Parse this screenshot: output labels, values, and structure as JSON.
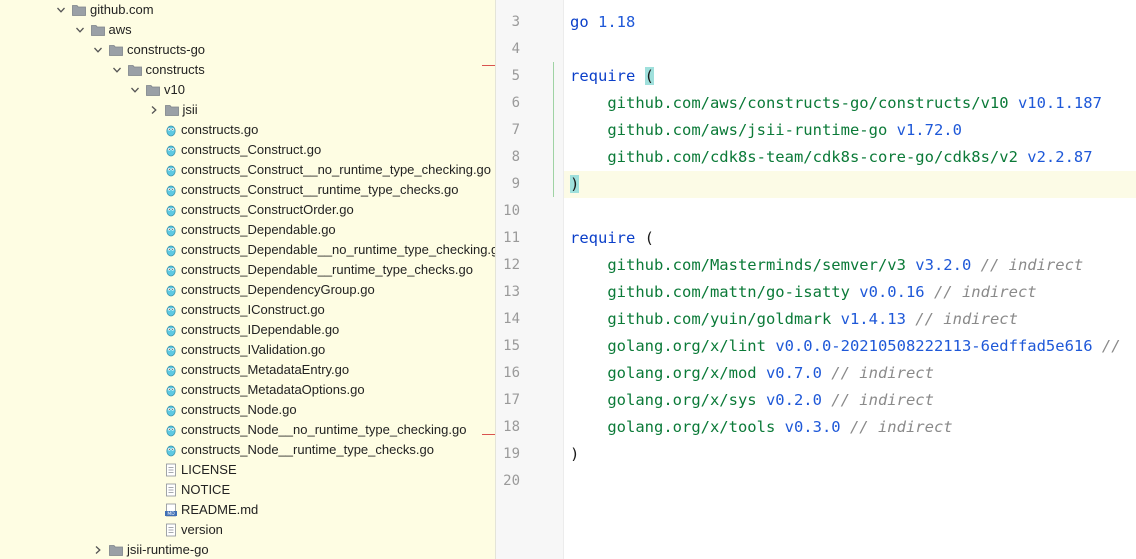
{
  "project_tree": {
    "nodes": [
      {
        "label": "github.com",
        "type": "folder",
        "expanded": true,
        "depth": 0
      },
      {
        "label": "aws",
        "type": "folder",
        "expanded": true,
        "depth": 1
      },
      {
        "label": "constructs-go",
        "type": "folder",
        "expanded": true,
        "depth": 2
      },
      {
        "label": "constructs",
        "type": "folder",
        "expanded": true,
        "depth": 3
      },
      {
        "label": "v10",
        "type": "folder",
        "expanded": true,
        "depth": 4
      },
      {
        "label": "jsii",
        "type": "folder",
        "expanded": false,
        "depth": 5
      },
      {
        "label": "constructs.go",
        "type": "go",
        "depth": 6
      },
      {
        "label": "constructs_Construct.go",
        "type": "go",
        "depth": 6
      },
      {
        "label": "constructs_Construct__no_runtime_type_checking.go",
        "type": "go",
        "depth": 6
      },
      {
        "label": "constructs_Construct__runtime_type_checks.go",
        "type": "go",
        "depth": 6
      },
      {
        "label": "constructs_ConstructOrder.go",
        "type": "go",
        "depth": 6
      },
      {
        "label": "constructs_Dependable.go",
        "type": "go",
        "depth": 6
      },
      {
        "label": "constructs_Dependable__no_runtime_type_checking.go",
        "type": "go",
        "depth": 6
      },
      {
        "label": "constructs_Dependable__runtime_type_checks.go",
        "type": "go",
        "depth": 6
      },
      {
        "label": "constructs_DependencyGroup.go",
        "type": "go",
        "depth": 6
      },
      {
        "label": "constructs_IConstruct.go",
        "type": "go",
        "depth": 6
      },
      {
        "label": "constructs_IDependable.go",
        "type": "go",
        "depth": 6
      },
      {
        "label": "constructs_IValidation.go",
        "type": "go",
        "depth": 6
      },
      {
        "label": "constructs_MetadataEntry.go",
        "type": "go",
        "depth": 6
      },
      {
        "label": "constructs_MetadataOptions.go",
        "type": "go",
        "depth": 6
      },
      {
        "label": "constructs_Node.go",
        "type": "go",
        "depth": 6
      },
      {
        "label": "constructs_Node__no_runtime_type_checking.go",
        "type": "go",
        "depth": 6
      },
      {
        "label": "constructs_Node__runtime_type_checks.go",
        "type": "go",
        "depth": 6
      },
      {
        "label": "LICENSE",
        "type": "text",
        "depth": 6
      },
      {
        "label": "NOTICE",
        "type": "text",
        "depth": 6
      },
      {
        "label": "README.md",
        "type": "md",
        "depth": 6
      },
      {
        "label": "version",
        "type": "text",
        "depth": 6
      },
      {
        "label": "jsii-runtime-go",
        "type": "folder",
        "expanded": false,
        "depth": 2
      }
    ]
  },
  "editor": {
    "lines": [
      {
        "num": "3",
        "tokens": [
          {
            "t": "go ",
            "c": "kw"
          },
          {
            "t": "1.18",
            "c": "ver"
          }
        ]
      },
      {
        "num": "4",
        "tokens": []
      },
      {
        "num": "5",
        "tokens": [
          {
            "t": "require ",
            "c": "kw"
          },
          {
            "t": "(",
            "c": "hl"
          }
        ]
      },
      {
        "num": "6",
        "tokens": [
          {
            "t": "    github.com/aws/constructs-go/constructs/v10 ",
            "c": "path"
          },
          {
            "t": "v10.1.187",
            "c": "ver"
          }
        ]
      },
      {
        "num": "7",
        "tokens": [
          {
            "t": "    github.com/aws/jsii-runtime-go ",
            "c": "path"
          },
          {
            "t": "v1.72.0",
            "c": "ver"
          }
        ]
      },
      {
        "num": "8",
        "tokens": [
          {
            "t": "    github.com/cdk8s-team/cdk8s-core-go/cdk8s/v2 ",
            "c": "path"
          },
          {
            "t": "v2.2.87",
            "c": "ver"
          }
        ]
      },
      {
        "num": "9",
        "tokens": [
          {
            "t": ")",
            "c": "hl"
          }
        ]
      },
      {
        "num": "10",
        "tokens": []
      },
      {
        "num": "11",
        "tokens": [
          {
            "t": "require ",
            "c": "kw"
          },
          {
            "t": "(",
            "c": "paren"
          }
        ]
      },
      {
        "num": "12",
        "tokens": [
          {
            "t": "    github.com/Masterminds/semver/v3 ",
            "c": "path"
          },
          {
            "t": "v3.2.0",
            "c": "ver"
          },
          {
            "t": " // indirect",
            "c": "cmt"
          }
        ]
      },
      {
        "num": "13",
        "tokens": [
          {
            "t": "    github.com/mattn/go-isatty ",
            "c": "path"
          },
          {
            "t": "v0.0.16",
            "c": "ver"
          },
          {
            "t": " // indirect",
            "c": "cmt"
          }
        ]
      },
      {
        "num": "14",
        "tokens": [
          {
            "t": "    github.com/yuin/goldmark ",
            "c": "path"
          },
          {
            "t": "v1.4.13",
            "c": "ver"
          },
          {
            "t": " // indirect",
            "c": "cmt"
          }
        ]
      },
      {
        "num": "15",
        "tokens": [
          {
            "t": "    golang.org/x/lint ",
            "c": "path"
          },
          {
            "t": "v0.0.0-20210508222113-6edffad5e616",
            "c": "ver"
          },
          {
            "t": " //",
            "c": "cmt"
          }
        ]
      },
      {
        "num": "16",
        "tokens": [
          {
            "t": "    golang.org/x/mod ",
            "c": "path"
          },
          {
            "t": "v0.7.0",
            "c": "ver"
          },
          {
            "t": " // indirect",
            "c": "cmt"
          }
        ]
      },
      {
        "num": "17",
        "tokens": [
          {
            "t": "    golang.org/x/sys ",
            "c": "path"
          },
          {
            "t": "v0.2.0",
            "c": "ver"
          },
          {
            "t": " // indirect",
            "c": "cmt"
          }
        ]
      },
      {
        "num": "18",
        "tokens": [
          {
            "t": "    golang.org/x/tools ",
            "c": "path"
          },
          {
            "t": "v0.3.0",
            "c": "ver"
          },
          {
            "t": " // indirect",
            "c": "cmt"
          }
        ]
      },
      {
        "num": "19",
        "tokens": [
          {
            "t": ")",
            "c": "paren"
          }
        ]
      },
      {
        "num": "20",
        "tokens": []
      }
    ],
    "current_line": "9"
  },
  "icons": {
    "folder": "folder-icon",
    "go_file": "go-file-icon",
    "text_file": "text-file-icon",
    "md_file": "markdown-file-icon",
    "chevron_down": "chevron-down-icon",
    "chevron_right": "chevron-right-icon"
  },
  "colors": {
    "tree_bg": "#fefde3",
    "keyword": "#0b3fc9",
    "version": "#1e58d8",
    "path": "#0b7a38",
    "comment": "#8a8a8a",
    "bracket_highlight": "#9fe0dc"
  }
}
